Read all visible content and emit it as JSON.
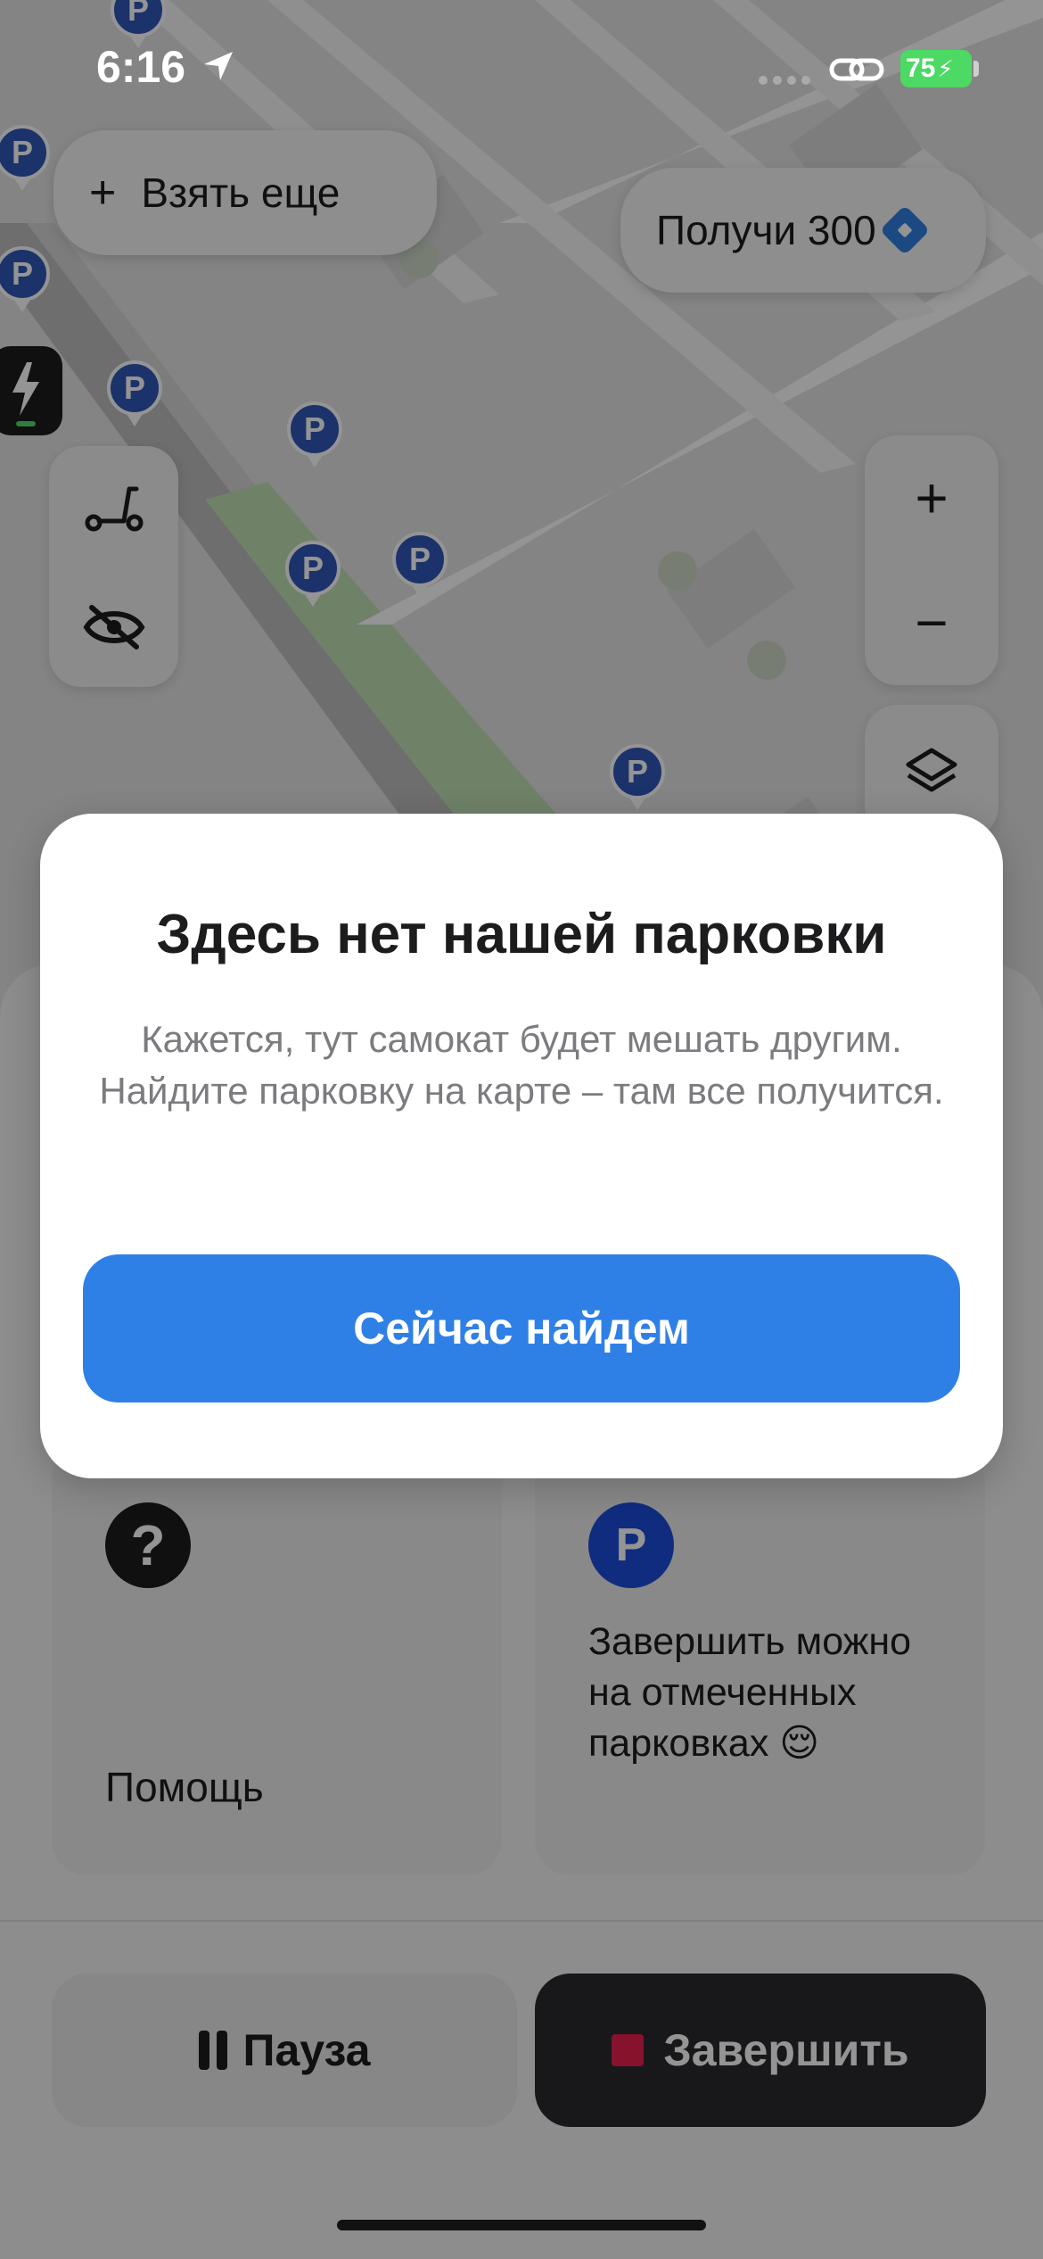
{
  "status_bar": {
    "time": "6:16",
    "battery": "75",
    "icons": [
      "location-arrow-icon",
      "signal-dots-icon",
      "link-icon",
      "battery-charging-icon"
    ]
  },
  "map": {
    "take_more_label": "Взять еще",
    "get_bonus_label": "Получи 300",
    "parking_pin_letter": "P",
    "controls": [
      "scooter-icon",
      "hide-eye-icon",
      "zoom-in-icon",
      "zoom-out-icon",
      "layers-icon"
    ]
  },
  "modal": {
    "title": "Здесь нет нашей парковки",
    "text": "Кажется, тут самокат будет мешать другим. Найдите парковку на карте – там все получится.",
    "button_label": "Сейчас найдем"
  },
  "cards": {
    "help_icon": "?",
    "help_label": "Помощь",
    "parking_icon": "P",
    "parking_text": "Завершить можно на отмеченных парковках 😌"
  },
  "actions": {
    "pause_label": "Пауза",
    "finish_label": "Завершить"
  },
  "colors": {
    "accent_blue": "#2f80e6",
    "parking_blue": "#2f56b8",
    "finish_dark": "#2a2a30",
    "stop_red": "#e8204d",
    "battery_green": "#4cd964"
  }
}
